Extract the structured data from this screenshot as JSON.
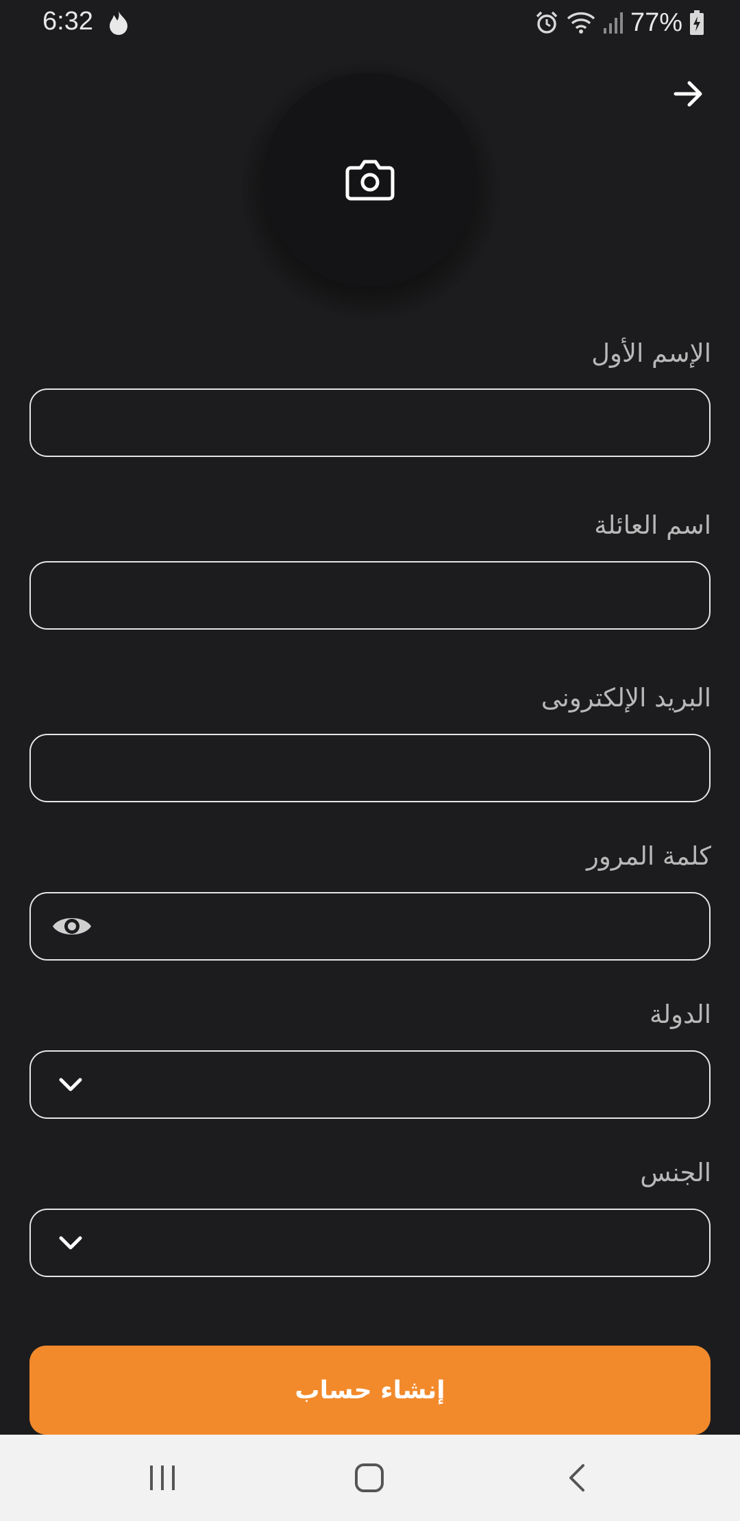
{
  "status_bar": {
    "time": "6:32",
    "battery": "77%"
  },
  "form": {
    "first_name_label": "الإسم الأول",
    "last_name_label": "اسم العائلة",
    "email_label": "البريد الإلكترونى",
    "password_label": "كلمة المرور",
    "country_label": "الدولة",
    "gender_label": "الجنس",
    "submit_label": "إنشاء حساب"
  },
  "colors": {
    "background": "#1c1c1e",
    "accent": "#f28a2c",
    "field_border": "#e6e6e6",
    "nav_bar": "#f2f2f2"
  },
  "icons": [
    "flame-icon",
    "alarm-icon",
    "wifi-icon",
    "signal-icon",
    "battery-icon",
    "arrow-right-icon",
    "camera-icon",
    "eye-icon",
    "chevron-down-icon",
    "recents-icon",
    "home-icon",
    "back-icon"
  ]
}
